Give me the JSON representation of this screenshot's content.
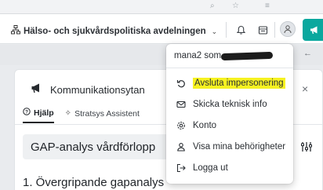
{
  "header": {
    "org_selector_label": "Hälso- och sjukvårdspolitiska avdelningen"
  },
  "user_menu": {
    "user_name": "mana2 som",
    "items": [
      {
        "label": "Avsluta impersonering",
        "icon": "undo-icon"
      },
      {
        "label": "Skicka teknisk info",
        "icon": "mail-icon"
      },
      {
        "label": "Konto",
        "icon": "gear-icon"
      },
      {
        "label": "Visa mina behörigheter",
        "icon": "person-icon"
      },
      {
        "label": "Logga ut",
        "icon": "logout-icon"
      }
    ],
    "highlight_color": "#f6f221"
  },
  "panel": {
    "title": "Kommunikationsytan",
    "tabs": [
      {
        "label": "Hjälp",
        "icon": "help-circle-icon",
        "active": true
      },
      {
        "label": "Stratsys Assistent",
        "icon": "sparkle-icon",
        "active": false
      }
    ]
  },
  "content": {
    "gap_title": "GAP-analys vårdförlopp",
    "section_title": "1. Övergripande gapanalys"
  },
  "colors": {
    "accent": "#0aa89e",
    "background": "#e9ebee"
  }
}
